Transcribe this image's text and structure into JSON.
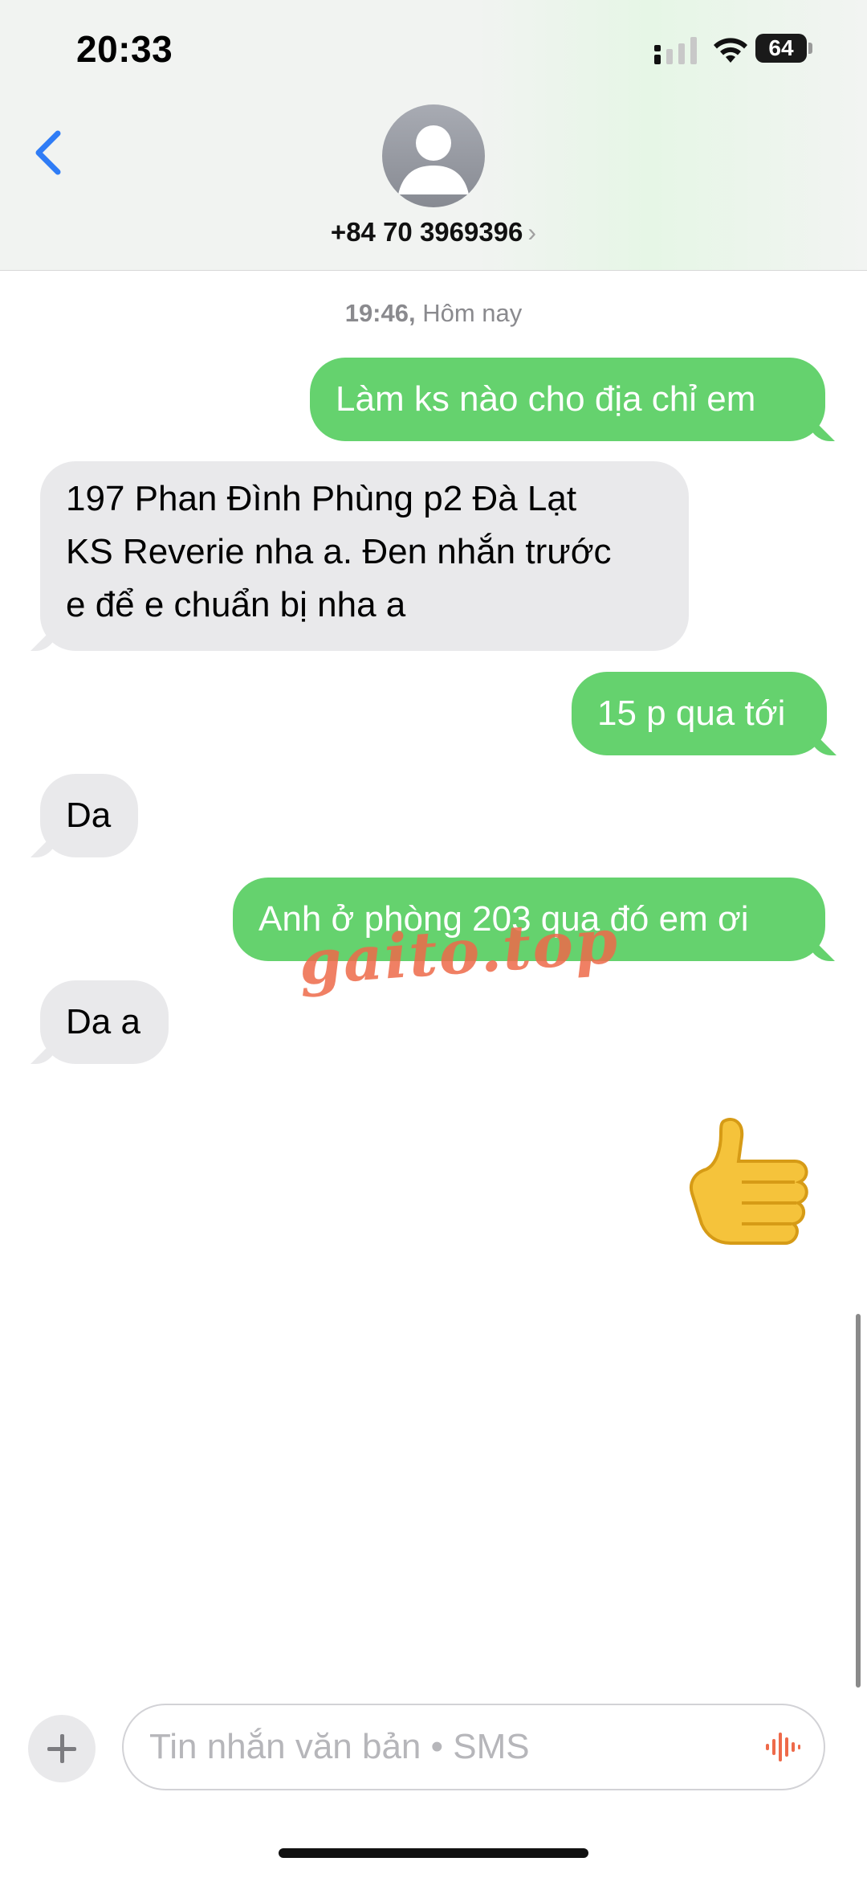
{
  "status_bar": {
    "time": "20:33",
    "battery": "64"
  },
  "header": {
    "contact": "+84 70 3969396",
    "chevron": "›"
  },
  "conversation": {
    "timestamp_bold": "19:46,",
    "timestamp_rest": " Hôm nay",
    "messages": [
      {
        "direction": "outgoing",
        "text": "Làm ks nào cho địa chỉ em"
      },
      {
        "direction": "incoming",
        "text": "197 Phan Đình Phùng p2 Đà Lạt\nKS Reverie nha a. Đen nhắn trước\ne để e chuẩn bị nha a"
      },
      {
        "direction": "outgoing",
        "text": "15 p qua tới"
      },
      {
        "direction": "incoming",
        "text": "Da"
      },
      {
        "direction": "outgoing",
        "text": "Anh ở phòng 203 qua đó em ơi"
      },
      {
        "direction": "incoming",
        "text": "Da a"
      }
    ],
    "reaction": "thumbs-up-emoji",
    "watermark": "gaito.top"
  },
  "input": {
    "placeholder": "Tin nhắn văn bản • SMS"
  },
  "colors": {
    "outgoing": "#65d26e",
    "incoming": "#e9e9eb",
    "accent": "#2f7cf6"
  }
}
